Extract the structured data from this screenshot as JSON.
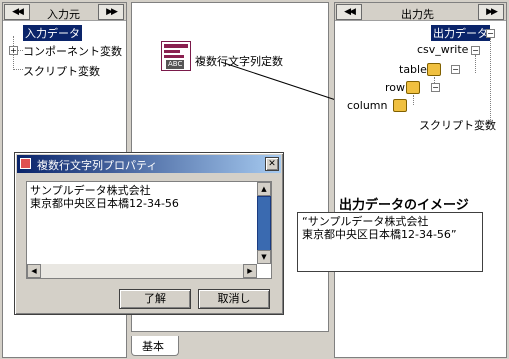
{
  "left_panel": {
    "header_title": "入力元",
    "prev_icon": "double-left-arrow",
    "next_icon": "double-right-arrow",
    "nav_prev_glyph": "◀◀",
    "nav_next_glyph": "▶▶",
    "tree": {
      "root": "入力データ",
      "items": [
        "コンポーネント変数",
        "スクリプト変数"
      ],
      "expander": "+"
    }
  },
  "center_panel": {
    "node_label": "複数行文字列定数",
    "icon_text": "ABC",
    "tab_label": "基本"
  },
  "right_panel": {
    "header_title": "出力先",
    "nav_prev_glyph": "◀◀",
    "nav_next_glyph": "▶▶",
    "tree": {
      "root": "出力データ",
      "csv_write": "csv_write",
      "table": "table",
      "row": "row",
      "column": "column",
      "script_var": "スクリプト変数",
      "expander": "−"
    }
  },
  "output_preview": {
    "title": "出力データのイメージ",
    "text": "“サンプルデータ株式会社\n東京都中央区日本橋12-34-56”"
  },
  "dialog": {
    "title": "複数行文字列プロパティ",
    "close_glyph": "✕",
    "text": "サンプルデータ株式会社\n東京都中央区日本橋12-34-56",
    "ok_label": "了解",
    "cancel_label": "取消し"
  },
  "colors": {
    "selection": "#0a246a",
    "window_bg": "#d4d0c8",
    "title_gradient_start": "#0a246a",
    "title_gradient_end": "#a6caf0"
  }
}
